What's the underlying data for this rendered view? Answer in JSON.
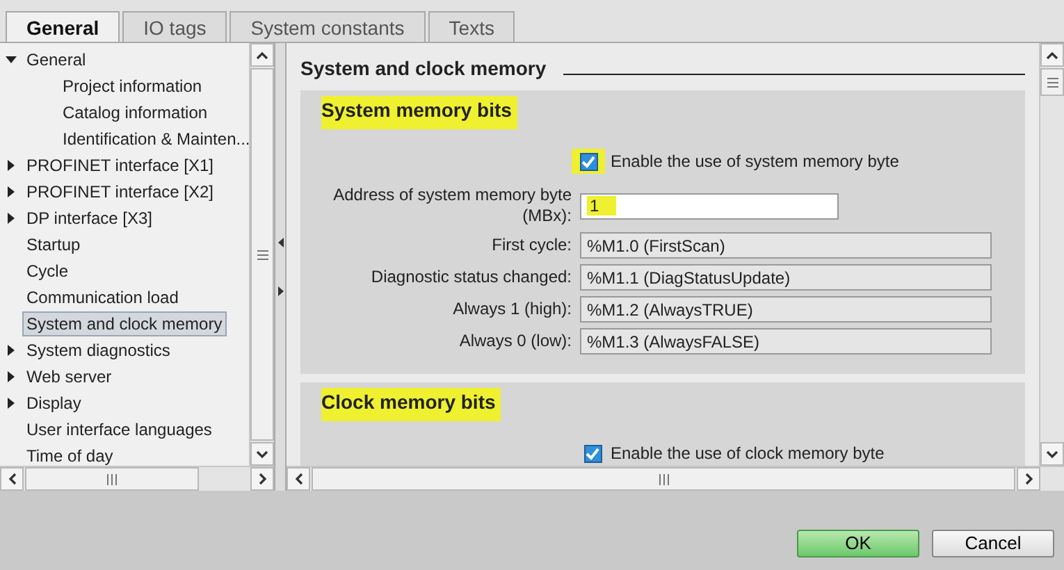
{
  "tabs": [
    {
      "label": "General",
      "selected": true,
      "highlighted": true
    },
    {
      "label": "IO tags",
      "selected": false,
      "highlighted": false
    },
    {
      "label": "System constants",
      "selected": false,
      "highlighted": false
    },
    {
      "label": "Texts",
      "selected": false,
      "highlighted": false
    }
  ],
  "tree": {
    "items": [
      {
        "label": "General",
        "kind": "group",
        "expanded": true,
        "selected": false,
        "highlighted": false,
        "children": [
          {
            "label": "Project information",
            "kind": "page",
            "selected": false,
            "highlighted": false
          },
          {
            "label": "Catalog information",
            "kind": "page",
            "selected": false,
            "highlighted": false
          },
          {
            "label": "Identification & Mainten...",
            "kind": "page",
            "selected": false,
            "highlighted": false
          }
        ]
      },
      {
        "label": "PROFINET interface [X1]",
        "kind": "group",
        "expanded": false,
        "selected": false,
        "highlighted": false
      },
      {
        "label": "PROFINET interface [X2]",
        "kind": "group",
        "expanded": false,
        "selected": false,
        "highlighted": false
      },
      {
        "label": "DP interface [X3]",
        "kind": "group",
        "expanded": false,
        "selected": false,
        "highlighted": false
      },
      {
        "label": "Startup",
        "kind": "page",
        "selected": false,
        "highlighted": false
      },
      {
        "label": "Cycle",
        "kind": "page",
        "selected": false,
        "highlighted": false
      },
      {
        "label": "Communication load",
        "kind": "page",
        "selected": false,
        "highlighted": false
      },
      {
        "label": "System and clock memory",
        "kind": "page",
        "selected": true,
        "highlighted": true
      },
      {
        "label": "System diagnostics",
        "kind": "group",
        "expanded": false,
        "selected": false,
        "highlighted": false
      },
      {
        "label": "Web server",
        "kind": "group",
        "expanded": false,
        "selected": false,
        "highlighted": false
      },
      {
        "label": "Display",
        "kind": "group",
        "expanded": false,
        "selected": false,
        "highlighted": false
      },
      {
        "label": "User interface languages",
        "kind": "page",
        "selected": false,
        "highlighted": false
      },
      {
        "label": "Time of day",
        "kind": "page",
        "selected": false,
        "highlighted": false
      }
    ]
  },
  "content": {
    "title": "System and clock memory",
    "sections": [
      {
        "title": "System memory bits",
        "highlighted": true,
        "rows": [
          {
            "kind": "checkbox",
            "label": "Enable the use of system memory byte",
            "checked": true,
            "highlighted": true
          },
          {
            "kind": "input",
            "label": "Address of system memory byte (MBx):",
            "value": "1",
            "highlighted": true
          },
          {
            "kind": "readonly",
            "label": "First cycle:",
            "value": "%M1.0 (FirstScan)"
          },
          {
            "kind": "readonly",
            "label": "Diagnostic status changed:",
            "value": "%M1.1 (DiagStatusUpdate)"
          },
          {
            "kind": "readonly",
            "label": "Always 1 (high):",
            "value": "%M1.2 (AlwaysTRUE)"
          },
          {
            "kind": "readonly",
            "label": "Always 0 (low):",
            "value": "%M1.3 (AlwaysFALSE)"
          }
        ]
      },
      {
        "title": "Clock memory bits",
        "highlighted": true,
        "rows": [
          {
            "kind": "checkbox",
            "label": "Enable the use of clock memory byte",
            "checked": true,
            "highlighted": false
          }
        ]
      }
    ]
  },
  "buttons": [
    {
      "label": "OK",
      "kind": "primary"
    },
    {
      "label": "Cancel",
      "kind": "secondary"
    }
  ]
}
